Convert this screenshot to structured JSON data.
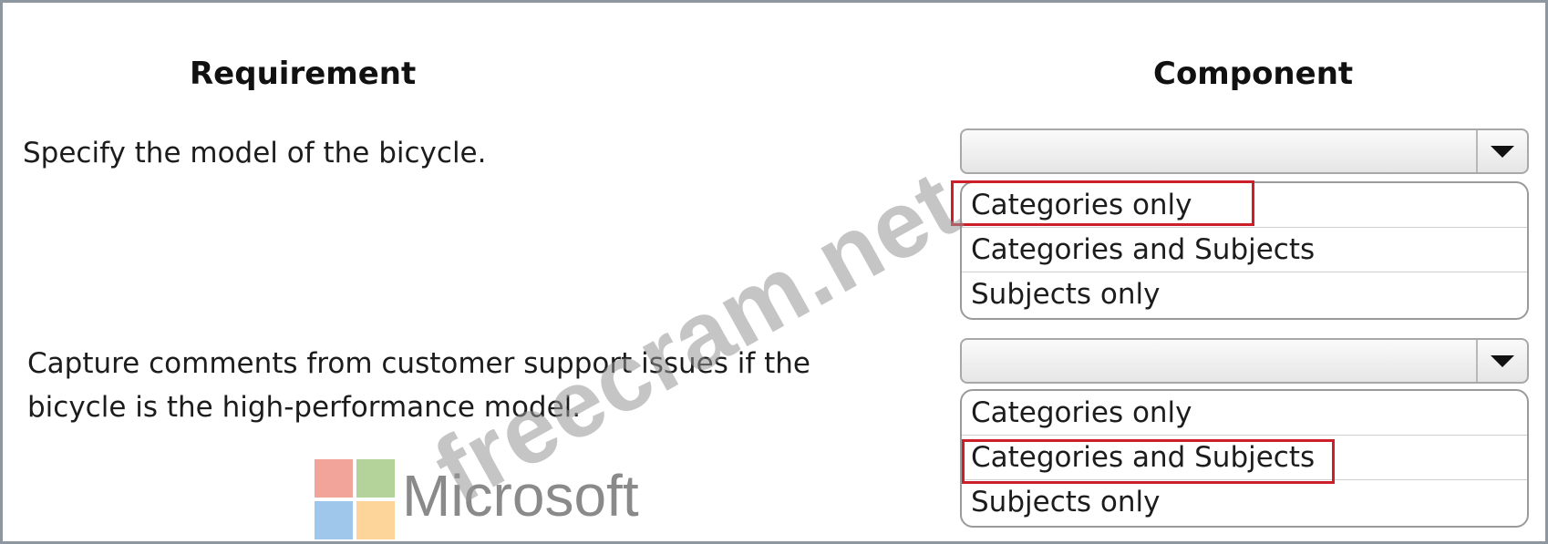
{
  "headers": {
    "requirement": "Requirement",
    "component": "Component"
  },
  "rows": [
    {
      "requirement": "Specify the model of the bicycle.",
      "options": [
        "Categories only",
        "Categories and Subjects",
        "Subjects only"
      ],
      "selected": "Categories only"
    },
    {
      "requirement": "Capture comments from customer support issues if the bicycle is the high-performance model.",
      "options": [
        "Categories only",
        "Categories and Subjects",
        "Subjects only"
      ],
      "selected": "Categories and Subjects"
    }
  ],
  "logo": {
    "text": "Microsoft"
  },
  "watermark": {
    "text": "freecram.net"
  },
  "colors": {
    "highlight": "#cc1f2a",
    "logo_red": "#f2a39a",
    "logo_green": "#b3d39a",
    "logo_blue": "#9fc7ec",
    "logo_yellow": "#fdd49a"
  },
  "icons": {
    "dropdown": "triangle-down-icon"
  }
}
